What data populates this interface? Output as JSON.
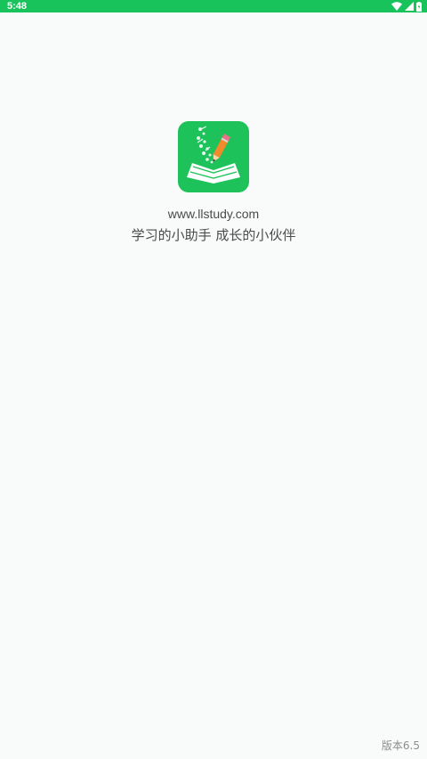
{
  "status_bar": {
    "time": "5:48",
    "icons": [
      "wifi-icon",
      "cell-signal-icon",
      "battery-icon"
    ],
    "background_color": "#18c35b"
  },
  "splash": {
    "logo_icon": "book-pencil-logo-icon",
    "logo_color": "#1dc25a",
    "website": "www.llstudy.com",
    "slogan": "学习的小助手 成长的小伙伴",
    "version": "版本6.5"
  }
}
